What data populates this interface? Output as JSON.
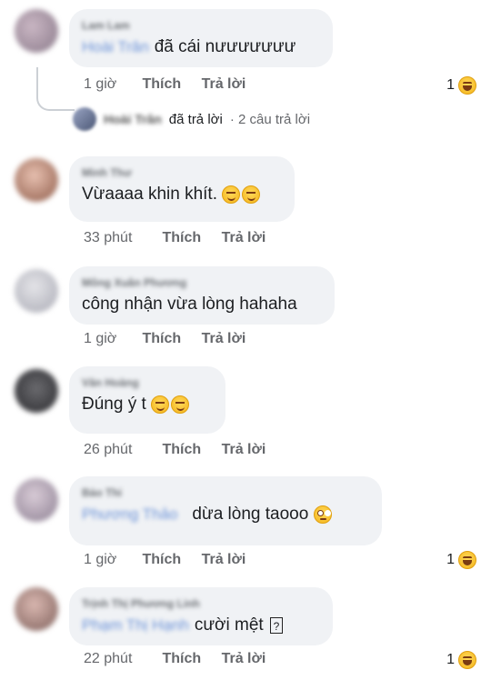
{
  "comments": [
    {
      "author": "Lam Lam",
      "mention": "Hoài Trân",
      "text": "đã cái nưưưưưưư",
      "time": "1 giờ",
      "like_label": "Thích",
      "reply_label": "Trả lời",
      "reaction_count": "1",
      "reaction_icon": "laugh-emoji-icon",
      "replies": {
        "replier": "Hoài Trân",
        "summary_text": "đã trả lời",
        "count_text": "· 2 câu trả lời"
      }
    },
    {
      "author": "Minh Thư",
      "text": "Vừaaaa khin khít.",
      "emojis": [
        "smirk-emoji-icon",
        "smirk-emoji-icon"
      ],
      "time": "33 phút",
      "like_label": "Thích",
      "reply_label": "Trả lời"
    },
    {
      "author": "Mông Xuân Phương",
      "text": "công nhận vừa lòng hahaha",
      "time": "1 giờ",
      "like_label": "Thích",
      "reply_label": "Trả lời"
    },
    {
      "author": "Văn Hoàng",
      "text": "Đúng ý t",
      "emojis": [
        "smirk-emoji-icon",
        "smirk-emoji-icon"
      ],
      "time": "26 phút",
      "like_label": "Thích",
      "reply_label": "Trả lời"
    },
    {
      "author": "Bảo Thi",
      "mention": "Phương Thảo",
      "text": "dừa lòng taooo",
      "emojis": [
        "roll-eyes-emoji-icon"
      ],
      "time": "1 giờ",
      "like_label": "Thích",
      "reply_label": "Trả lời",
      "reaction_count": "1",
      "reaction_icon": "laugh-emoji-icon"
    },
    {
      "author": "Trịnh Thị Phương Linh",
      "mention": "Phạm Thị Hạnh",
      "text": "cười mệt",
      "trailing_glyph": "?",
      "time": "22 phút",
      "like_label": "Thích",
      "reply_label": "Trả lời",
      "reaction_count": "1",
      "reaction_icon": "laugh-emoji-icon"
    }
  ]
}
